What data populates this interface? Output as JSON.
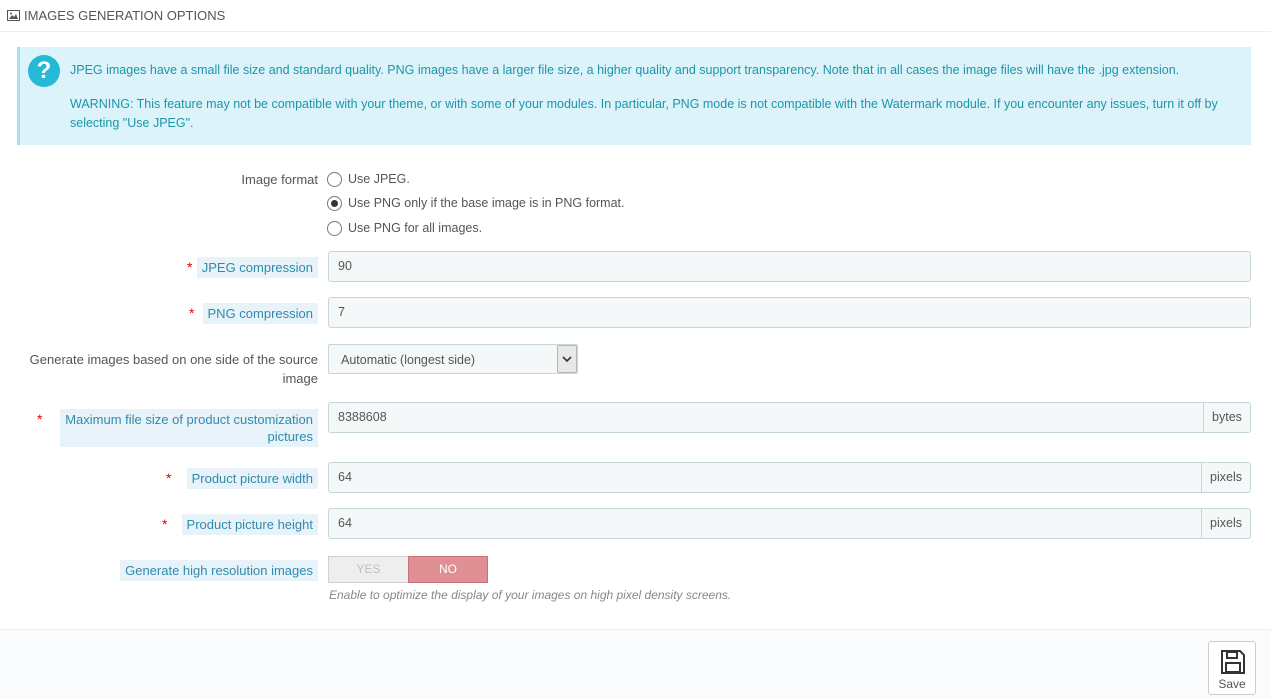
{
  "header": {
    "title": "IMAGES GENERATION OPTIONS",
    "icon": "image-icon"
  },
  "alert": {
    "icon": "question-icon",
    "paragraph1": "JPEG images have a small file size and standard quality. PNG images have a larger file size, a higher quality and support transparency. Note that in all cases the image files will have the .jpg extension.",
    "paragraph2": "WARNING: This feature may not be compatible with your theme, or with some of your modules. In particular, PNG mode is not compatible with the Watermark module. If you encounter any issues, turn it off by selecting \"Use JPEG\"."
  },
  "image_format": {
    "label": "Image format",
    "options": [
      {
        "label": "Use JPEG.",
        "checked": false
      },
      {
        "label": "Use PNG only if the base image is in PNG format.",
        "checked": true
      },
      {
        "label": "Use PNG for all images.",
        "checked": false
      }
    ]
  },
  "jpeg_compression": {
    "label": "JPEG compression",
    "required_mark": "*",
    "value": "90"
  },
  "png_compression": {
    "label": "PNG compression",
    "required_mark": "*",
    "value": "7"
  },
  "generate_side": {
    "label_line1": "Generate images based on one side of the source",
    "label_line2": "image",
    "selected": "Automatic (longest side)"
  },
  "max_file_size": {
    "label_line1": "Maximum file size of product customization",
    "label_line2": "pictures",
    "required_mark": "*",
    "value": "8388608",
    "unit": "bytes"
  },
  "picture_width": {
    "label": "Product picture width",
    "required_mark": "*",
    "value": "64",
    "unit": "pixels"
  },
  "picture_height": {
    "label": "Product picture height",
    "required_mark": "*",
    "value": "64",
    "unit": "pixels"
  },
  "high_res": {
    "label": "Generate high resolution images",
    "yes_label": "YES",
    "no_label": "NO",
    "value": "NO",
    "help": "Enable to optimize the display of your images on high pixel density screens."
  },
  "footer": {
    "save_label": "Save",
    "save_icon": "floppy-disk-icon"
  },
  "colors": {
    "alert_bg": "#dcf4f9",
    "alert_text": "#1e94ab",
    "accent": "#25b9d7",
    "required": "#e30000",
    "switch_no": "#e08f95"
  }
}
